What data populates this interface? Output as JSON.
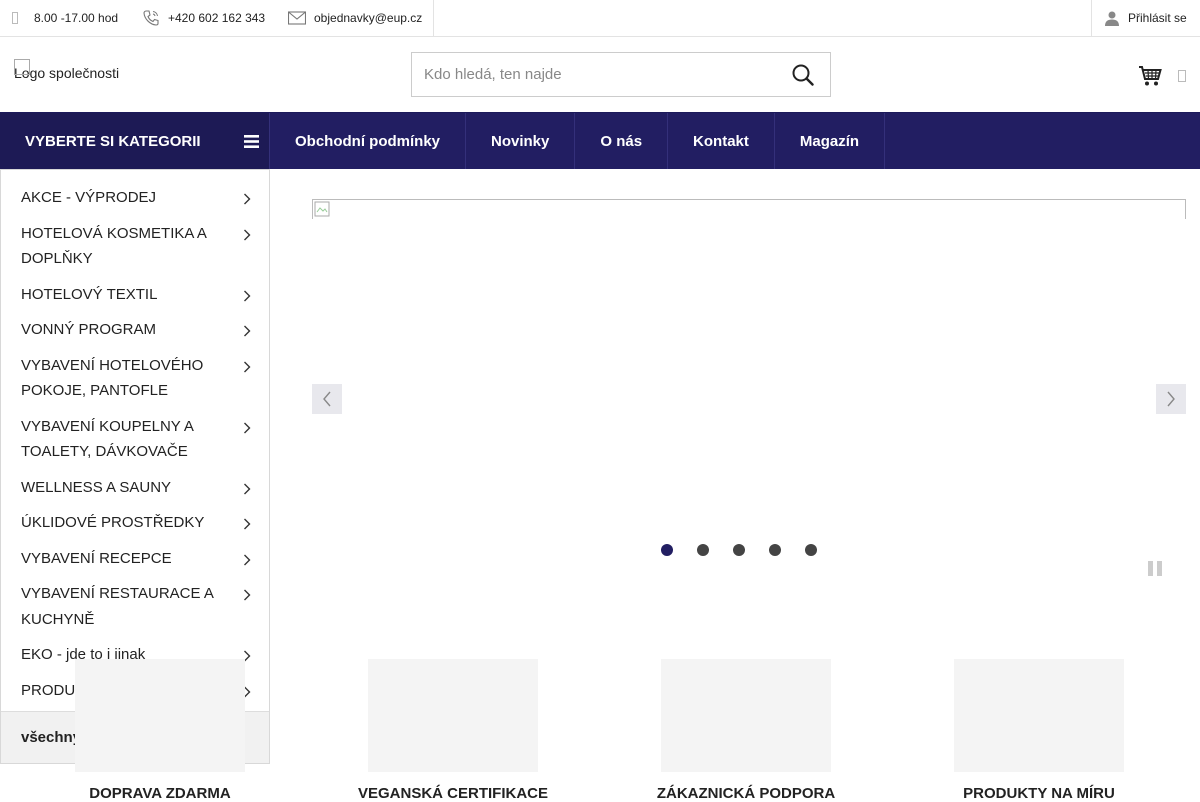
{
  "topbar": {
    "hours": "8.00 -17.00 hod",
    "phone": "+420 602 162 343",
    "email": "objednavky@eup.cz",
    "login": "Přihlásit se"
  },
  "header": {
    "logo_alt": "Logo společnosti",
    "search_placeholder": "Kdo hledá, ten najde"
  },
  "nav": {
    "categories_toggle": "VYBERTE SI KATEGORII",
    "links": [
      "Obchodní podmínky",
      "Novinky",
      "O nás",
      "Kontakt",
      "Magazín"
    ]
  },
  "sidebar": {
    "categories": [
      "AKCE - VÝPRODEJ",
      "HOTELOVÁ KOSMETIKA A DOPLŇKY",
      "HOTELOVÝ TEXTIL",
      "VONNÝ PROGRAM",
      "VYBAVENÍ HOTELOVÉHO POKOJE, PANTOFLE",
      "VYBAVENÍ KOUPELNY A TOALETY, DÁVKOVAČE",
      "WELLNESS A SAUNY",
      "ÚKLIDOVÉ PROSTŘEDKY",
      "VYBAVENÍ RECEPCE",
      "VYBAVENÍ RESTAURACE A KUCHYNĚ",
      "EKO - jde to i jinak",
      "PRODUKTY NA MÍRU"
    ],
    "all_categories": "všechny kategorie"
  },
  "slider": {
    "dot_count": 5,
    "active_dot": 0
  },
  "benefits": [
    "DOPRAVA ZDARMA",
    "VEGANSKÁ CERTIFIKACE",
    "ZÁKAZNICKÁ PODPORA",
    "PRODUKTY NA MÍRU"
  ],
  "colors": {
    "brand_navy": "#221e62",
    "dot_inactive": "#444444"
  }
}
